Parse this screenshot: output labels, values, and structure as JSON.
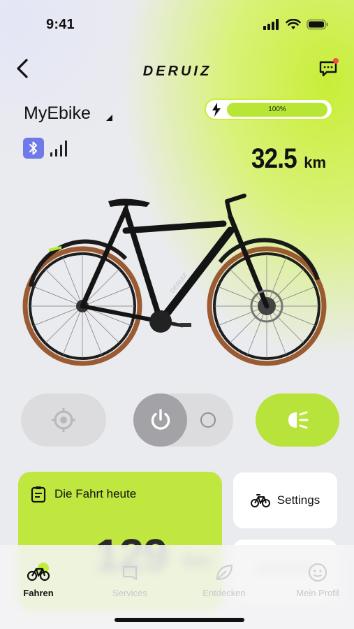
{
  "status_bar": {
    "time": "9:41"
  },
  "header": {
    "brand": "DERUIZ"
  },
  "bike": {
    "name": "MyEbike",
    "battery_percent_text": "100%",
    "battery_level": 1.0,
    "distance_value": "32.5",
    "distance_unit": "km"
  },
  "ride_card": {
    "title": "Die Fahrt heute",
    "value": "129",
    "unit": "km"
  },
  "settings_card": {
    "label": "Settings"
  },
  "tabs": [
    {
      "label": "Fahren",
      "icon": "bike-icon",
      "active": true
    },
    {
      "label": "Services",
      "icon": "tag-icon",
      "active": false
    },
    {
      "label": "Entdecken",
      "icon": "leaf-icon",
      "active": false
    },
    {
      "label": "Mein Profil",
      "icon": "smiley-icon",
      "active": false
    }
  ],
  "colors": {
    "accent": "#c3ea3c",
    "bluetooth": "#6f79e8",
    "notification": "#ff4a4a"
  }
}
